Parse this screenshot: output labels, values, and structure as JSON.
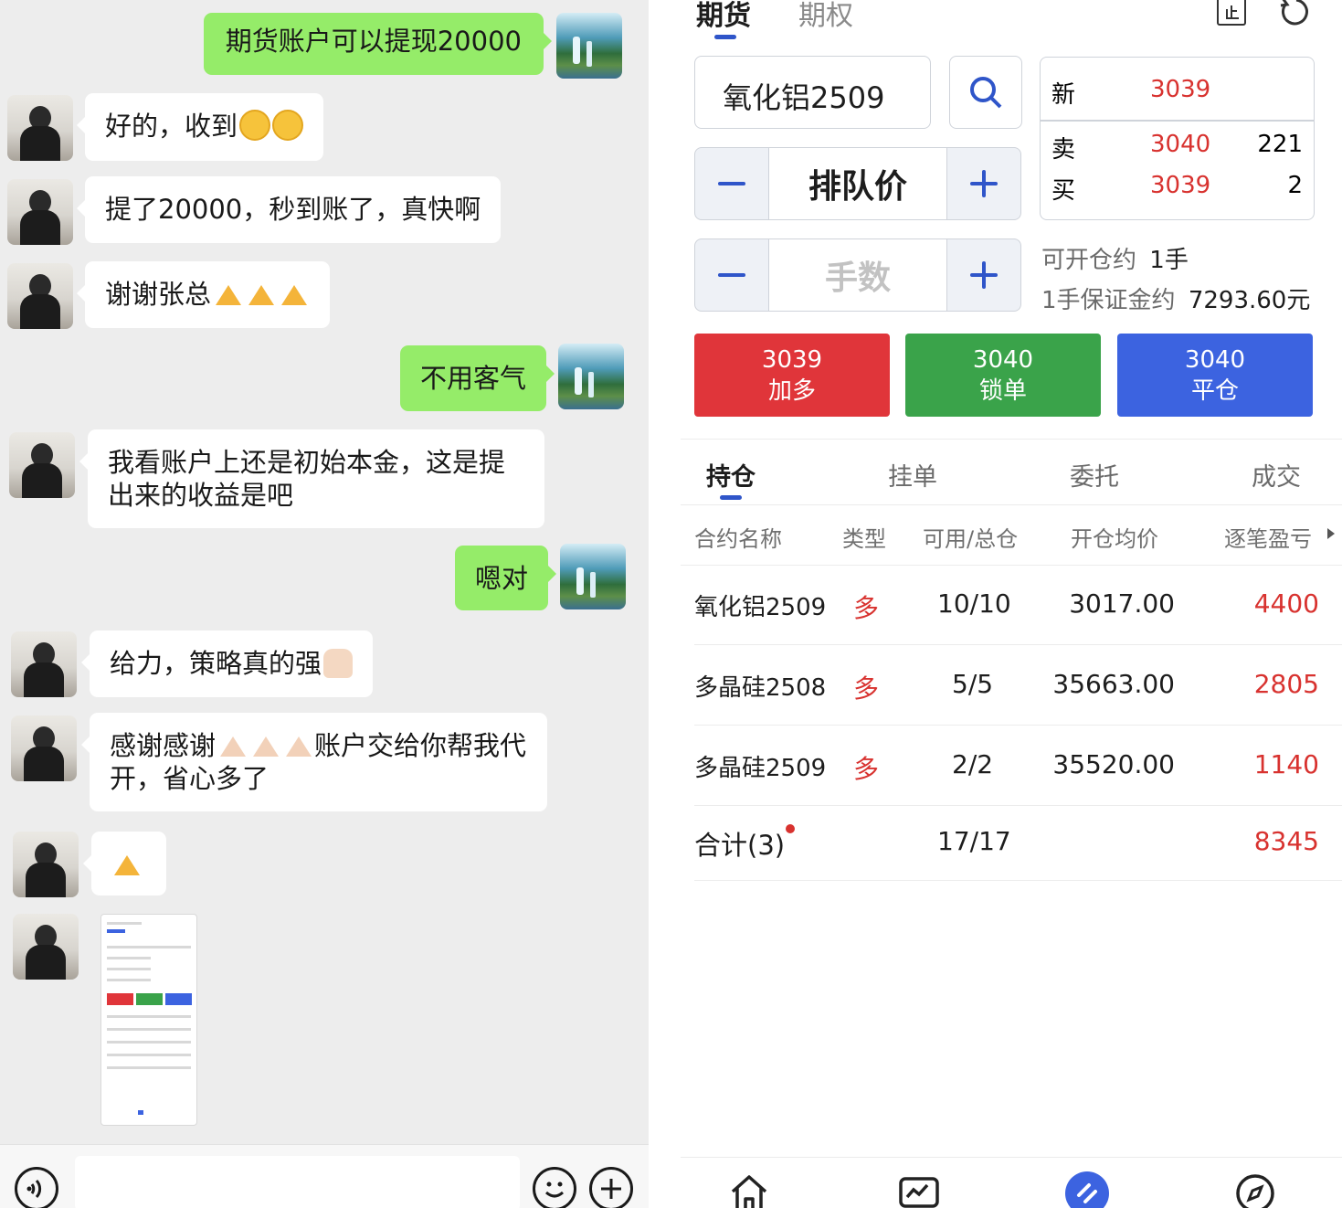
{
  "chat": {
    "messages": [
      {
        "side": "out",
        "text": "期货账户可以提现20000"
      },
      {
        "side": "in",
        "text": "好的，收到",
        "emoji": "😏😏"
      },
      {
        "side": "in",
        "text": "提了20000，秒到账了，真快啊"
      },
      {
        "side": "in",
        "text": "谢谢张总",
        "emoji": "🙏🙏🙏"
      },
      {
        "side": "out",
        "text": "不用客气"
      },
      {
        "side": "in",
        "text": "我看账户上还是初始本金，这是提出来的收益是吧"
      },
      {
        "side": "out",
        "text": "嗯对"
      },
      {
        "side": "in",
        "text": "给力，策略真的强",
        "emoji": "👍"
      },
      {
        "side": "in",
        "text_a": "感谢感谢",
        "emoji": "🙏🙏🙏",
        "text_b": "账户交给你帮我代开，省心多了"
      },
      {
        "side": "in",
        "emoji": "🙏"
      },
      {
        "side": "in",
        "type": "image",
        "alt": "trading screenshot thumbnail"
      }
    ],
    "input": {
      "value": "",
      "placeholder": ""
    },
    "icons": {
      "voice": "voice-icon",
      "emoji": "emoji-icon",
      "more": "plus-icon"
    }
  },
  "trade": {
    "top_tabs": [
      "期货",
      "期权"
    ],
    "top_icons": [
      "stop-icon",
      "refresh-icon"
    ],
    "contract": "氧化铝2509",
    "price_mode": "排队价",
    "lots_placeholder": "手数",
    "quote": {
      "new_label": "新",
      "new_price": "3039",
      "sell_label": "卖",
      "sell_price": "3040",
      "sell_qty": "221",
      "buy_label": "买",
      "buy_price": "3039",
      "buy_qty": "2"
    },
    "can_open": {
      "label": "可开仓约",
      "value": "1手"
    },
    "margin": {
      "label": "1手保证金约",
      "value": "7293.60元"
    },
    "actions": [
      {
        "price": "3039",
        "label": "加多",
        "color": "#e0353a"
      },
      {
        "price": "3040",
        "label": "锁单",
        "color": "#3aa34a"
      },
      {
        "price": "3040",
        "label": "平仓",
        "color": "#3c63e0"
      }
    ],
    "tabs": [
      "持仓",
      "挂单",
      "委托",
      "成交"
    ],
    "columns": [
      "合约名称",
      "类型",
      "可用/总仓",
      "开仓均价",
      "逐笔盈亏"
    ],
    "positions": [
      {
        "name": "氧化铝2509",
        "type": "多",
        "qty": "10/10",
        "avg": "3017.00",
        "pnl": "4400"
      },
      {
        "name": "多晶硅2508",
        "type": "多",
        "qty": "5/5",
        "avg": "35663.00",
        "pnl": "2805"
      },
      {
        "name": "多晶硅2509",
        "type": "多",
        "qty": "2/2",
        "avg": "35520.00",
        "pnl": "1140"
      }
    ],
    "total": {
      "label": "合计(3)",
      "qty": "17/17",
      "pnl": "8345"
    },
    "nav_icons": [
      "home-icon",
      "chart-icon",
      "trade-icon",
      "compass-icon"
    ],
    "colors": {
      "accent": "#2f55c9",
      "up": "#d8322f",
      "chat_green": "#95ec69"
    }
  }
}
